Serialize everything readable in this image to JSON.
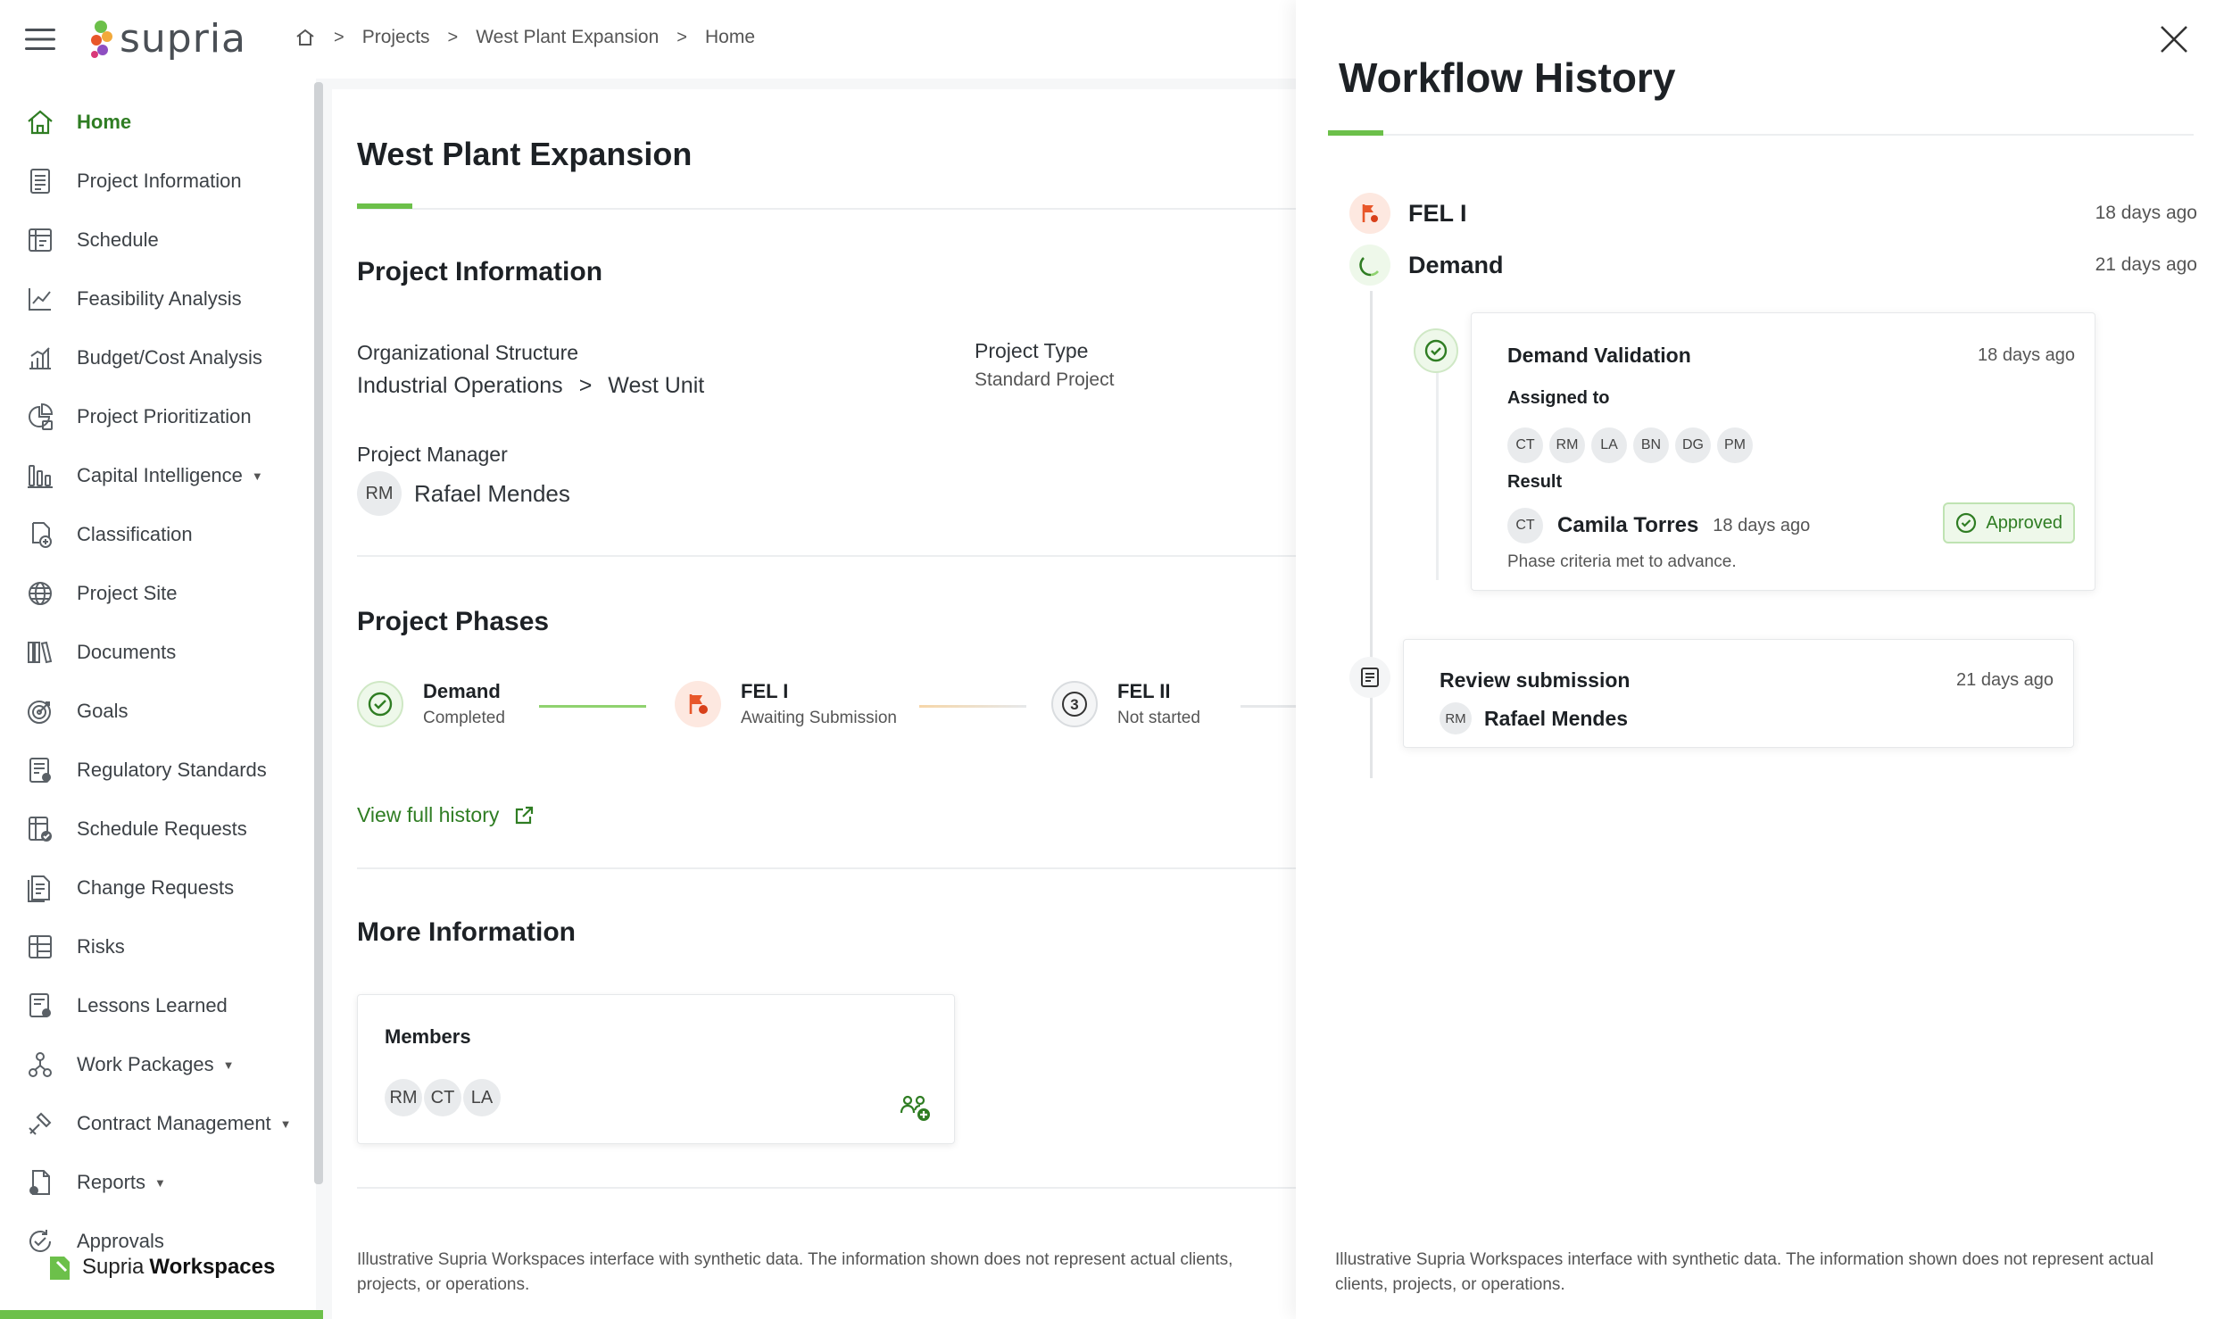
{
  "app": {
    "logo_text": "supria"
  },
  "breadcrumb": [
    "Projects",
    "West Plant Expansion",
    "Home"
  ],
  "sidebar": {
    "items": [
      {
        "label": "Home",
        "icon": "home-icon",
        "active": true
      },
      {
        "label": "Project Information",
        "icon": "document-icon"
      },
      {
        "label": "Schedule",
        "icon": "schedule-icon"
      },
      {
        "label": "Feasibility Analysis",
        "icon": "line-chart-icon"
      },
      {
        "label": "Budget/Cost Analysis",
        "icon": "bar-chart-icon"
      },
      {
        "label": "Project Prioritization",
        "icon": "pie-chart-icon"
      },
      {
        "label": "Capital Intelligence",
        "icon": "columns-icon",
        "caret": true
      },
      {
        "label": "Classification",
        "icon": "classification-icon"
      },
      {
        "label": "Project Site",
        "icon": "globe-icon"
      },
      {
        "label": "Documents",
        "icon": "books-icon"
      },
      {
        "label": "Goals",
        "icon": "target-icon"
      },
      {
        "label": "Regulatory Standards",
        "icon": "regulatory-icon"
      },
      {
        "label": "Schedule Requests",
        "icon": "schedule-request-icon"
      },
      {
        "label": "Change Requests",
        "icon": "change-request-icon"
      },
      {
        "label": "Risks",
        "icon": "risk-grid-icon"
      },
      {
        "label": "Lessons Learned",
        "icon": "lessons-icon"
      },
      {
        "label": "Work Packages",
        "icon": "work-package-icon",
        "caret": true
      },
      {
        "label": "Contract Management",
        "icon": "contract-icon",
        "caret": true
      },
      {
        "label": "Reports",
        "icon": "report-icon",
        "caret": true
      },
      {
        "label": "Approvals",
        "icon": "approval-icon"
      }
    ],
    "workspace": {
      "brand": "Supria",
      "name": "Workspaces"
    }
  },
  "main": {
    "title": "West Plant Expansion",
    "project_info": {
      "heading": "Project Information",
      "org_label": "Organizational Structure",
      "org_value_1": "Industrial Operations",
      "org_sep": ">",
      "org_value_2": "West Unit",
      "type_label": "Project Type",
      "type_value": "Standard Project",
      "manager_label": "Project Manager",
      "manager_initials": "RM",
      "manager_name": "Rafael Mendes"
    },
    "phases": {
      "heading": "Project Phases",
      "items": [
        {
          "name": "Demand",
          "status": "Completed"
        },
        {
          "name": "FEL I",
          "status": "Awaiting Submission"
        },
        {
          "name": "FEL II",
          "status": "Not started",
          "number": "3"
        }
      ],
      "history_link": "View full history"
    },
    "more": {
      "heading": "More Information",
      "members_title": "Members",
      "members": [
        "RM",
        "CT",
        "LA"
      ]
    },
    "footnote": "Illustrative Supria Workspaces interface with synthetic data. The information shown does not represent actual clients, projects, or operations."
  },
  "panel": {
    "title": "Workflow History",
    "entries": [
      {
        "name": "FEL I",
        "time": "18 days ago"
      },
      {
        "name": "Demand",
        "time": "21 days ago"
      }
    ],
    "validation": {
      "title": "Demand Validation",
      "time": "18 days ago",
      "assigned_label": "Assigned to",
      "assignees": [
        "CT",
        "RM",
        "LA",
        "BN",
        "DG",
        "PM"
      ],
      "result_label": "Result",
      "result_initials": "CT",
      "result_name": "Camila Torres",
      "result_time": "18 days ago",
      "result_status": "Approved",
      "note": "Phase criteria met to advance."
    },
    "review": {
      "title": "Review submission",
      "time": "21 days ago",
      "initials": "RM",
      "name": "Rafael Mendes"
    },
    "footnote": "Illustrative Supria Workspaces interface with synthetic data. The information shown does not represent actual clients, projects, or operations."
  },
  "colors": {
    "accent": "#6cc04a",
    "accent_dark": "#2f7d23",
    "warning": "#e8572a",
    "link": "#2f7d23"
  }
}
